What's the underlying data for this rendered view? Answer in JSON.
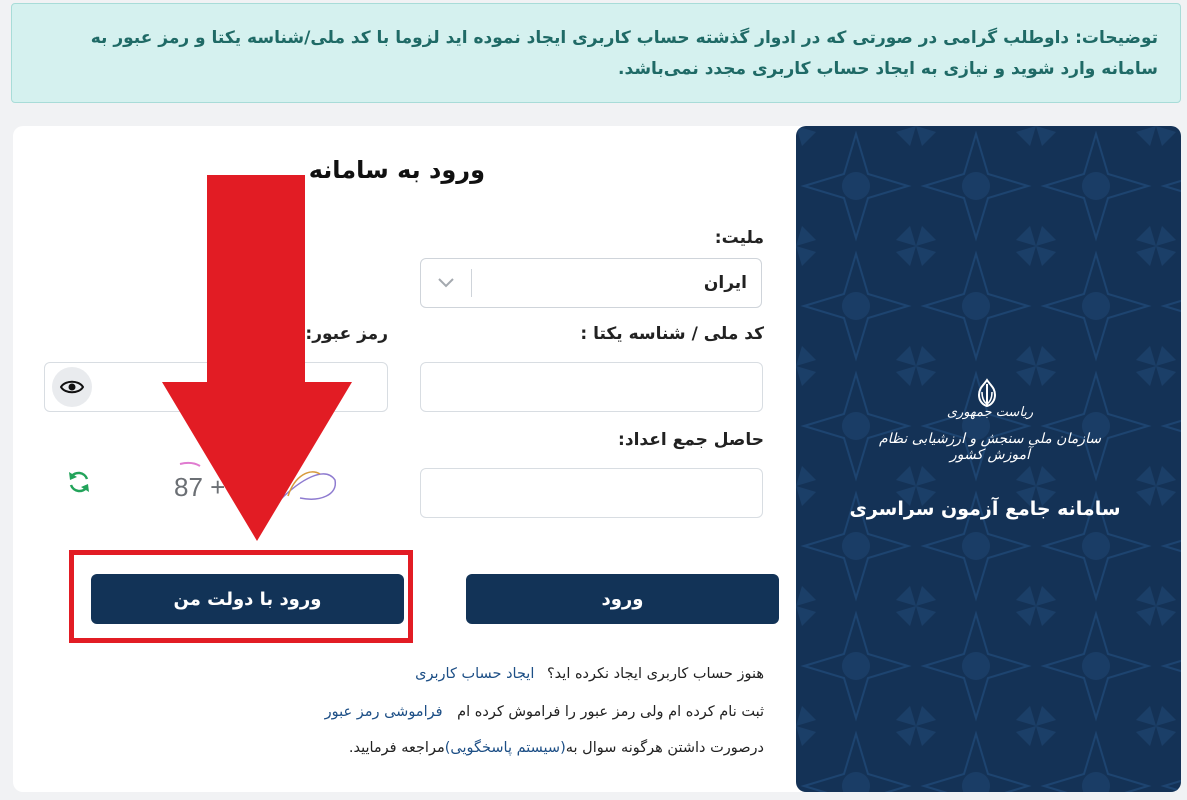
{
  "notice": {
    "text": "توضیحات: داوطلب گرامی در صورتی که در ادوار گذشته حساب کاربری ایجاد نموده اید لزوما با کد ملی/شناسه یکتا و رمز عبور به سامانه وارد شوید و نیازی به ایجاد حساب کاربری مجدد نمی‌باشد."
  },
  "login": {
    "title": "ورود به سامانه",
    "nationality_label": "ملیت:",
    "nationality_value": "ایران",
    "national_id_label": "کد ملی / شناسه یکتا :",
    "password_label": "رمز عبور:",
    "captcha_label": "حاصل جمع اعداد:",
    "captcha_text": "87 + ",
    "login_button": "ورود",
    "gov_login_button": "ورود با دولت من"
  },
  "help": {
    "no_account_text": "هنوز حساب کاربری ایجاد نکرده اید؟",
    "create_account_link": "ایجاد حساب کاربری",
    "forgot_text": "ثبت نام کرده ام ولی رمز عبور را فراموش کرده ام",
    "forgot_link": "فراموشی رمز عبور",
    "support_prefix": "درصورت داشتن هرگونه سوال به",
    "support_link": "(سیستم پاسخگویی)",
    "support_suffix": "مراجعه فرمایید."
  },
  "side": {
    "org_line1": "ریاست جمهوری",
    "org_line2": "سازمان ملی سنجش و ارزشیابی نظام آموزش کشور",
    "system_title": "سامانه جامع آزمون سراسری"
  },
  "colors": {
    "primary": "#123357",
    "notice_bg": "#d5f1ef",
    "notice_text": "#1f6a66",
    "highlight": "#e21c24"
  }
}
